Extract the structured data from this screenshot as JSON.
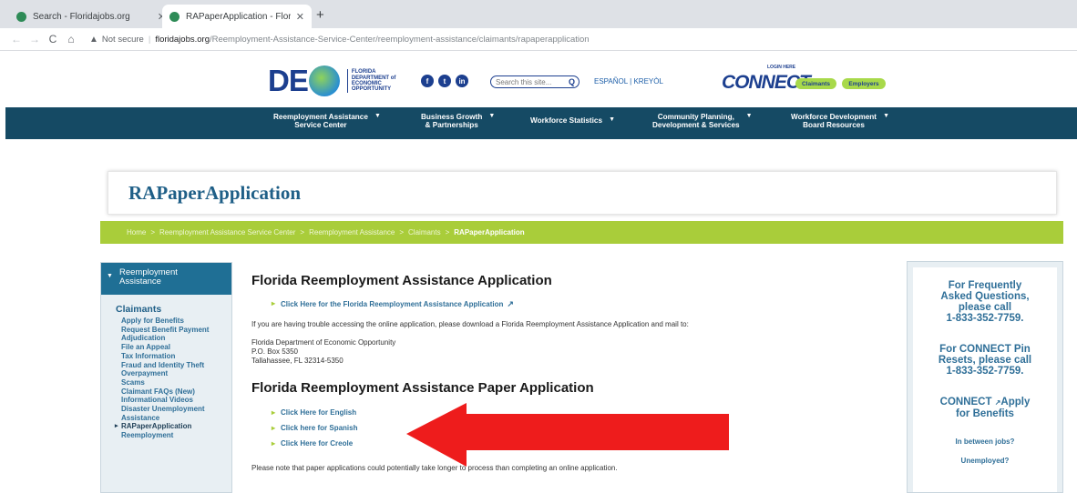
{
  "browser": {
    "tabs": [
      {
        "title": "Search - Floridajobs.org",
        "active": false
      },
      {
        "title": "RAPaperApplication - Floridajob",
        "active": true
      }
    ],
    "new_tab": "+",
    "nav": {
      "back": "←",
      "forward": "→",
      "reload": "C",
      "home": "⌂"
    },
    "security_label": "Not secure",
    "url_host": "floridajobs.org",
    "url_path": "/Reemployment-Assistance-Service-Center/reemployment-assistance/claimants/rapaperapplication"
  },
  "header": {
    "logo_letters": "DE",
    "logo_text": [
      "FLORIDA",
      "DEPARTMENT of",
      "ECONOMIC",
      "OPPORTUNITY"
    ],
    "social": [
      "f",
      "t",
      "in"
    ],
    "search_placeholder": "Search this site...",
    "lang_es": "ESPAÑOL",
    "lang_sep": "|",
    "lang_kr": "KREYÒL",
    "connect_login": "LOGIN HERE",
    "connect_word": "CONNECT",
    "claimants_button": "Claimants",
    "employers_button": "Employers"
  },
  "mainnav": [
    {
      "line1": "Reemployment Assistance",
      "line2": "Service Center"
    },
    {
      "line1": "Business Growth",
      "line2": "& Partnerships"
    },
    {
      "line1": "Workforce Statistics",
      "line2": ""
    },
    {
      "line1": "Community Planning,",
      "line2": "Development & Services"
    },
    {
      "line1": "Workforce Development",
      "line2": "Board Resources"
    }
  ],
  "page": {
    "title": "RAPaperApplication",
    "breadcrumb": [
      "Home",
      "Reemployment Assistance Service Center",
      "Reemployment Assistance",
      "Claimants",
      "RAPaperApplication"
    ]
  },
  "sidebar": {
    "header_line1": "Reemployment",
    "header_line2": "Assistance",
    "section": "Claimants",
    "links": [
      "Apply for Benefits",
      "Request Benefit Payment",
      "Adjudication",
      "File an Appeal",
      "Tax Information",
      "Fraud and Identity Theft",
      "Overpayment",
      "Scams",
      "Claimant FAQs (New)",
      "Informational Videos",
      "Disaster Unemployment",
      "Assistance",
      "RAPaperApplication",
      "Reemployment"
    ]
  },
  "content": {
    "heading1": "Florida Reemployment Assistance Application",
    "online_link": "Click Here for the Florida Reemployment Assistance Application",
    "trouble_text": "If you are having trouble accessing the online application, please download a Florida Reemployment Assistance Application and mail to:",
    "address": [
      "Florida Department of Economic Opportunity",
      "P.O. Box 5350",
      "Tallahassee, FL 32314-5350"
    ],
    "heading2": "Florida Reemployment Assistance Paper Application",
    "paper_links": [
      "Click Here for English",
      "Click here for Spanish",
      "Click Here for Creole"
    ],
    "note": "Please note that paper applications could potentially take longer to process than completing an online application."
  },
  "rightbox": {
    "faq": [
      "For Frequently",
      "Asked Questions,",
      "please call",
      "1-833-352-7759."
    ],
    "pin": [
      "For CONNECT Pin",
      "Resets, please call",
      "1-833-352-7759."
    ],
    "apply": [
      "CONNECT ",
      "Apply",
      "for Benefits"
    ],
    "in_between": "In between jobs?",
    "unemployed": "Unemployed?"
  },
  "colors": {
    "nav_bg": "#154a64",
    "breadcrumb_bg": "#a9cd3a",
    "link": "#2f6f98",
    "title": "#1f5f87",
    "arrow": "#ee1c1c"
  }
}
